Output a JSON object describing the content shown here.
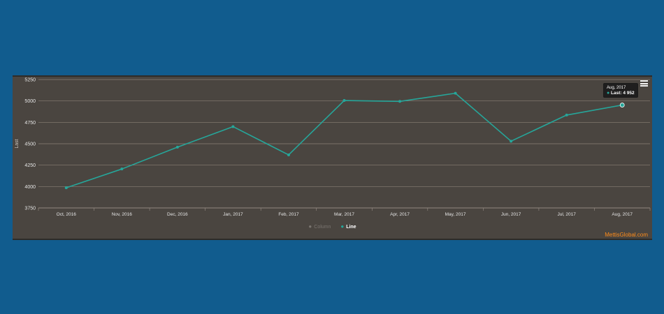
{
  "chart_data": {
    "type": "line",
    "title": "",
    "xlabel": "",
    "ylabel": "Last",
    "categories": [
      "Oct, 2016",
      "Nov, 2016",
      "Dec, 2016",
      "Jan, 2017",
      "Feb, 2017",
      "Mar, 2017",
      "Apr, 2017",
      "May, 2017",
      "Jun, 2017",
      "Jul, 2017",
      "Aug, 2017"
    ],
    "series": [
      {
        "name": "Line",
        "values": [
          3985,
          4205,
          4460,
          4700,
          4370,
          5005,
          4995,
          5090,
          4530,
          4835,
          4952
        ]
      }
    ],
    "ylim": [
      3750,
      5250
    ],
    "yticks": [
      "5250",
      "5000",
      "4750",
      "4500",
      "4250",
      "4000",
      "3750"
    ],
    "ytick_values": [
      5250,
      5000,
      4750,
      4500,
      4250,
      4000,
      3750
    ],
    "grid": true,
    "legend_position": "bottom-center",
    "legend": [
      {
        "label": "Column",
        "active": false
      },
      {
        "label": "Line",
        "active": true
      }
    ],
    "tooltip": {
      "date": "Aug, 2017",
      "label": "Last: 4 952",
      "index": 10
    },
    "colors": {
      "line": "#26a69a",
      "grid": "#8a8075",
      "axis_text": "#e6e6e6",
      "background": "#4a4540"
    }
  },
  "watermark": "MettisGlobal.com",
  "icons": {
    "menu": "hamburger-menu-icon"
  }
}
